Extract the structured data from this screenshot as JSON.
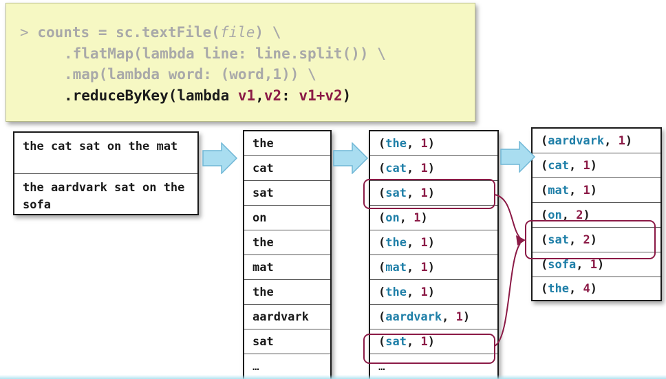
{
  "code": {
    "prompt": ">",
    "line1_pre": "counts = sc.textFile(",
    "line1_file": "file",
    "line1_post": ") \\",
    "line2": ".flatMap(lambda line: line.split()) \\",
    "line3": ".map(lambda word: (word,1)) \\",
    "line4_a": ".reduceByKey(lambda ",
    "line4_v1": "v1",
    "line4_comma": ",",
    "line4_v2": "v2",
    "line4_colon": ": ",
    "line4_v1b": "v1",
    "line4_plus": "+",
    "line4_v2b": "v2",
    "line4_close": ")"
  },
  "input_lines": [
    "the cat sat on the mat",
    "the aardvark sat on the sofa"
  ],
  "words": [
    "the",
    "cat",
    "sat",
    "on",
    "the",
    "mat",
    "the",
    "aardvark",
    "sat",
    "…"
  ],
  "pairs": [
    {
      "k": "the",
      "v": "1"
    },
    {
      "k": "cat",
      "v": "1"
    },
    {
      "k": "sat",
      "v": "1"
    },
    {
      "k": "on",
      "v": "1"
    },
    {
      "k": "the",
      "v": "1"
    },
    {
      "k": "mat",
      "v": "1"
    },
    {
      "k": "the",
      "v": "1"
    },
    {
      "k": "aardvark",
      "v": "1"
    },
    {
      "k": "sat",
      "v": "1"
    }
  ],
  "pairs_more": "…",
  "reduced": [
    {
      "k": "aardvark",
      "v": "1"
    },
    {
      "k": "cat",
      "v": "1"
    },
    {
      "k": "mat",
      "v": "1"
    },
    {
      "k": "on",
      "v": "2"
    },
    {
      "k": "sat",
      "v": "2"
    },
    {
      "k": "sofa",
      "v": "1"
    },
    {
      "k": "the",
      "v": "4"
    }
  ],
  "colors": {
    "key": "#1f7fa8",
    "number": "#8b1a46",
    "highlight": "#8b1a46",
    "arrow_fill": "#a9ddf0"
  }
}
